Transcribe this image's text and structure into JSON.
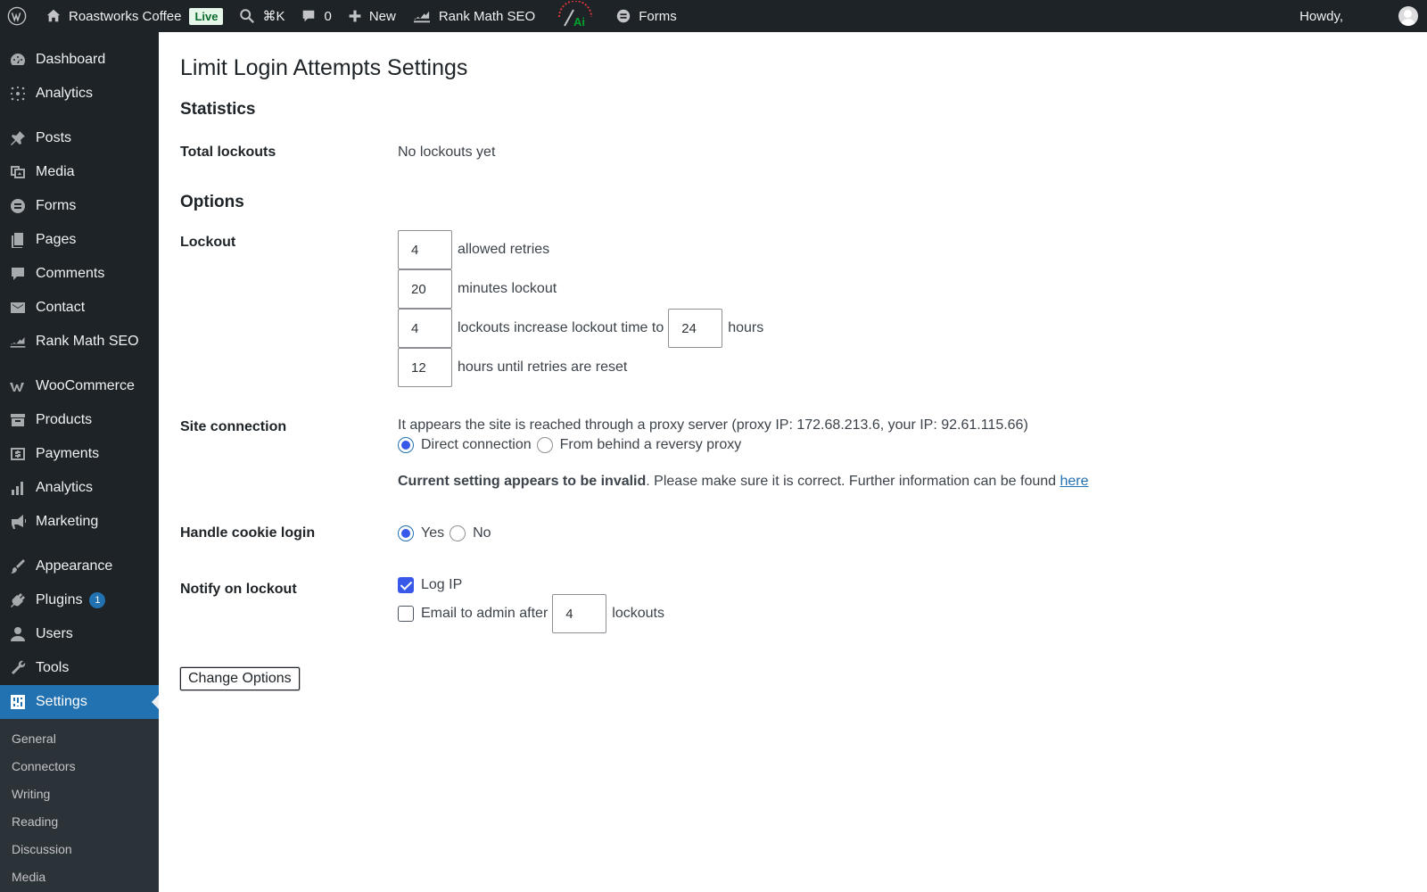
{
  "adminbar": {
    "site_name": "Roastworks Coffee",
    "live_badge": "Live",
    "search_shortcut": "⌘K",
    "comments_count": "0",
    "new_label": "New",
    "rankmath_label": "Rank Math SEO",
    "forms_label": "Forms",
    "howdy": "Howdy,"
  },
  "sidebar": {
    "items": [
      {
        "label": "Dashboard",
        "icon": "dashboard-icon"
      },
      {
        "label": "Analytics",
        "icon": "analytics-icon"
      },
      {
        "label": "Posts",
        "icon": "pin-icon"
      },
      {
        "label": "Media",
        "icon": "media-icon"
      },
      {
        "label": "Forms",
        "icon": "forms-icon"
      },
      {
        "label": "Pages",
        "icon": "pages-icon"
      },
      {
        "label": "Comments",
        "icon": "comment-icon"
      },
      {
        "label": "Contact",
        "icon": "mail-icon"
      },
      {
        "label": "Rank Math SEO",
        "icon": "rankmath-icon"
      },
      {
        "label": "WooCommerce",
        "icon": "woo-icon"
      },
      {
        "label": "Products",
        "icon": "archive-icon"
      },
      {
        "label": "Payments",
        "icon": "dollar-icon"
      },
      {
        "label": "Analytics",
        "icon": "bar-chart-icon"
      },
      {
        "label": "Marketing",
        "icon": "megaphone-icon"
      },
      {
        "label": "Appearance",
        "icon": "brush-icon"
      },
      {
        "label": "Plugins",
        "icon": "plugin-icon",
        "badge": "1"
      },
      {
        "label": "Users",
        "icon": "users-icon"
      },
      {
        "label": "Tools",
        "icon": "wrench-icon"
      },
      {
        "label": "Settings",
        "icon": "settings-icon"
      }
    ],
    "submenu": [
      "General",
      "Connectors",
      "Writing",
      "Reading",
      "Discussion",
      "Media"
    ]
  },
  "page": {
    "title": "Limit Login Attempts Settings",
    "statistics_heading": "Statistics",
    "total_lockouts_label": "Total lockouts",
    "total_lockouts_value": "No lockouts yet",
    "options_heading": "Options",
    "lockout_label": "Lockout",
    "allowed_retries_value": "4",
    "allowed_retries_text": "allowed retries",
    "minutes_lockout_value": "20",
    "minutes_lockout_text": "minutes lockout",
    "lockouts_increase_value": "4",
    "lockouts_increase_text": "lockouts increase lockout time to",
    "increase_hours_value": "24",
    "hours_text": "hours",
    "reset_hours_value": "12",
    "reset_hours_text": "hours until retries are reset",
    "site_connection_label": "Site connection",
    "proxy_message": "It appears the site is reached through a proxy server (proxy IP: 172.68.213.6, your IP: 92.61.115.66)",
    "direct_connection": "Direct connection",
    "reverse_proxy": "From behind a reversy proxy",
    "invalid_bold": "Current setting appears to be invalid",
    "invalid_rest": ". Please make sure it is correct. Further information can be found ",
    "here_link": "here",
    "handle_cookie_label": "Handle cookie login",
    "yes": "Yes",
    "no": "No",
    "notify_label": "Notify on lockout",
    "log_ip": "Log IP",
    "email_admin": "Email to admin after",
    "email_after_value": "4",
    "lockouts_text": "lockouts",
    "change_options": "Change Options"
  },
  "colors": {
    "admin_bg": "#1d2327",
    "accent": "#2271b1",
    "radio_check": "#3858e9"
  }
}
